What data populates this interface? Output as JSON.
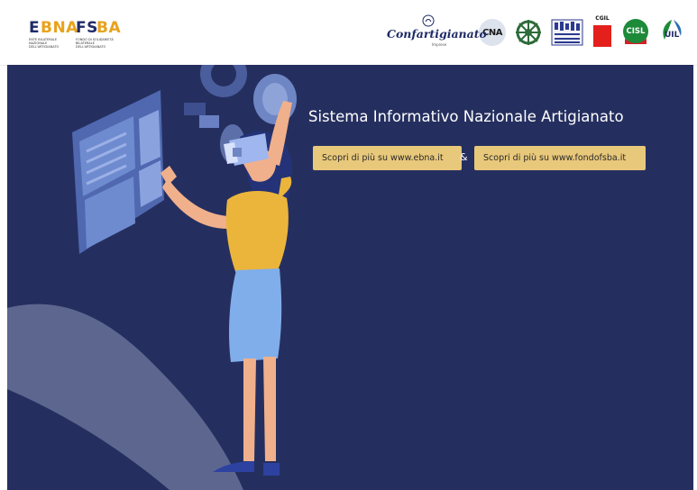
{
  "header": {
    "brand_left": {
      "part1": "E",
      "part2": "BNA",
      "part3": "FS",
      "part4": "BA",
      "sub_left": "ENTE BILATERALE NAZIONALE DELL'ARTIGIANATO",
      "sub_right": "FONDO DI SOLIDARIETÀ BILATERALE DELL'ARTIGIANATO"
    },
    "partners": {
      "confartigianato": "Confartigianato",
      "confartigianato_sub": "Imprese",
      "cna": "CNA",
      "cgil": "CGIL",
      "cisl": "CISL",
      "uil": "UIL"
    }
  },
  "hero": {
    "title": "Sistema Informativo Nazionale Artigianato",
    "button_ebna": "Scopri di più su www.ebna.it",
    "ampersand": "&",
    "button_fsba": "Scopri di più su www.fondofsba.it"
  },
  "colors": {
    "hero_bg": "#252f5f",
    "button_bg": "#e8c87a",
    "brand_navy": "#1f2a66",
    "brand_orange": "#e8a21c"
  }
}
